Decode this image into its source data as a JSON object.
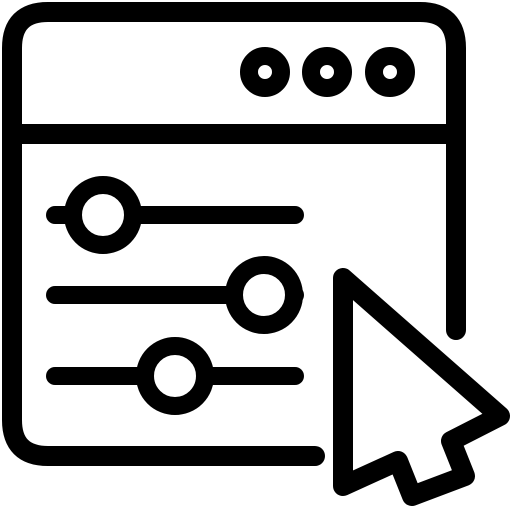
{
  "icon": {
    "name": "settings-sliders-window-with-cursor",
    "stroke_color": "#000000",
    "background_color": "#ffffff",
    "parts": {
      "window": "browser-window-icon",
      "window_controls": [
        "window-dot-icon",
        "window-dot-icon",
        "window-dot-icon"
      ],
      "sliders": [
        "slider-control",
        "slider-control",
        "slider-control"
      ],
      "cursor": "mouse-pointer-icon"
    }
  },
  "sliders": [
    {
      "name": "slider-1",
      "level": 0.2
    },
    {
      "name": "slider-2",
      "level": 0.85
    },
    {
      "name": "slider-3",
      "level": 0.5
    }
  ]
}
